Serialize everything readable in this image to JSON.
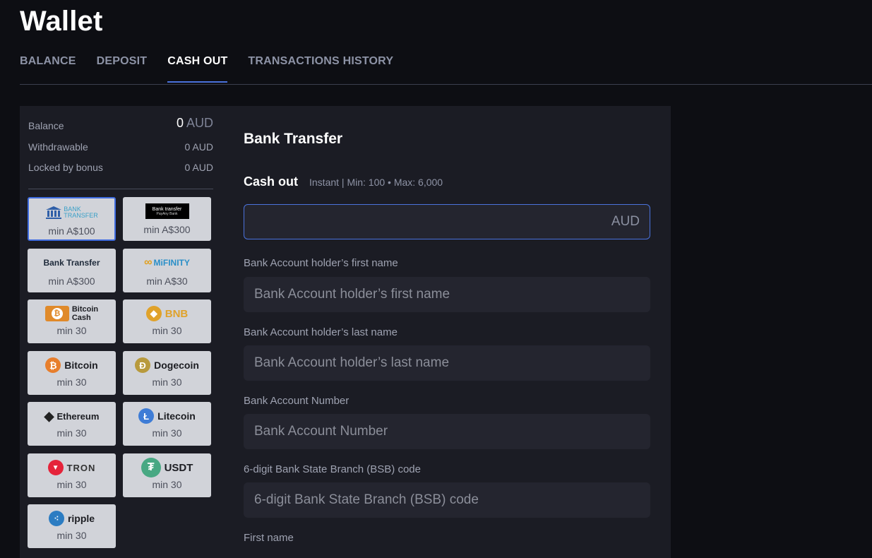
{
  "header": {
    "title": "Wallet"
  },
  "tabs": [
    {
      "label": "BALANCE"
    },
    {
      "label": "DEPOSIT"
    },
    {
      "label": "CASH OUT"
    },
    {
      "label": "TRANSACTIONS HISTORY"
    }
  ],
  "active_tab": "CASH OUT",
  "balance": {
    "balance_label": "Balance",
    "balance_amount": "0",
    "balance_currency": "AUD",
    "withdrawable_label": "Withdrawable",
    "withdrawable_value": "0 AUD",
    "locked_label": "Locked by bonus",
    "locked_value": "0 AUD"
  },
  "methods": [
    {
      "logo_top": "BANK",
      "logo_bottom": "TRANSFER",
      "min": "min A$100",
      "selected": true
    },
    {
      "logo_top": "Bank transfer",
      "logo_bottom": "PayAny Bank",
      "min": "min A$300"
    },
    {
      "logo": "Bank Transfer",
      "min": "min A$300"
    },
    {
      "logo": "MiFINITY",
      "min": "min A$30"
    },
    {
      "logo_top": "Bitcoin",
      "logo_bottom": "Cash",
      "min": "min 30",
      "color": "#e08a2a"
    },
    {
      "logo": "BNB",
      "min": "min 30",
      "color": "#e0a22a"
    },
    {
      "logo": "Bitcoin",
      "min": "min 30",
      "color": "#e77e2c",
      "glyph": "₿"
    },
    {
      "logo": "Dogecoin",
      "min": "min 30",
      "color": "#b89a3d",
      "glyph": "Ð"
    },
    {
      "logo": "Ethereum",
      "min": "min 30",
      "glyph": "◆"
    },
    {
      "logo": "Litecoin",
      "min": "min 30",
      "color": "#3e7cd6",
      "glyph": "Ł"
    },
    {
      "logo": "TRON",
      "min": "min 30",
      "color": "#e5233a"
    },
    {
      "logo": "USDT",
      "min": "min 30",
      "color": "#48a883",
      "glyph": "₮"
    },
    {
      "logo": "ripple",
      "min": "min 30",
      "color": "#2b7cc2"
    }
  ],
  "form": {
    "title": "Bank Transfer",
    "cashout_label": "Cash out",
    "cashout_meta": "Instant | Min: 100 • Max: 6,000",
    "amount_currency": "AUD",
    "fields": [
      {
        "label": "Bank Account holder’s first name",
        "placeholder": "Bank Account holder’s first name"
      },
      {
        "label": "Bank Account holder’s last name",
        "placeholder": "Bank Account holder’s last name"
      },
      {
        "label": "Bank Account Number",
        "placeholder": "Bank Account Number"
      },
      {
        "label": "6-digit Bank State Branch (BSB) code",
        "placeholder": "6-digit Bank State Branch (BSB) code"
      },
      {
        "label": "First name"
      }
    ]
  }
}
